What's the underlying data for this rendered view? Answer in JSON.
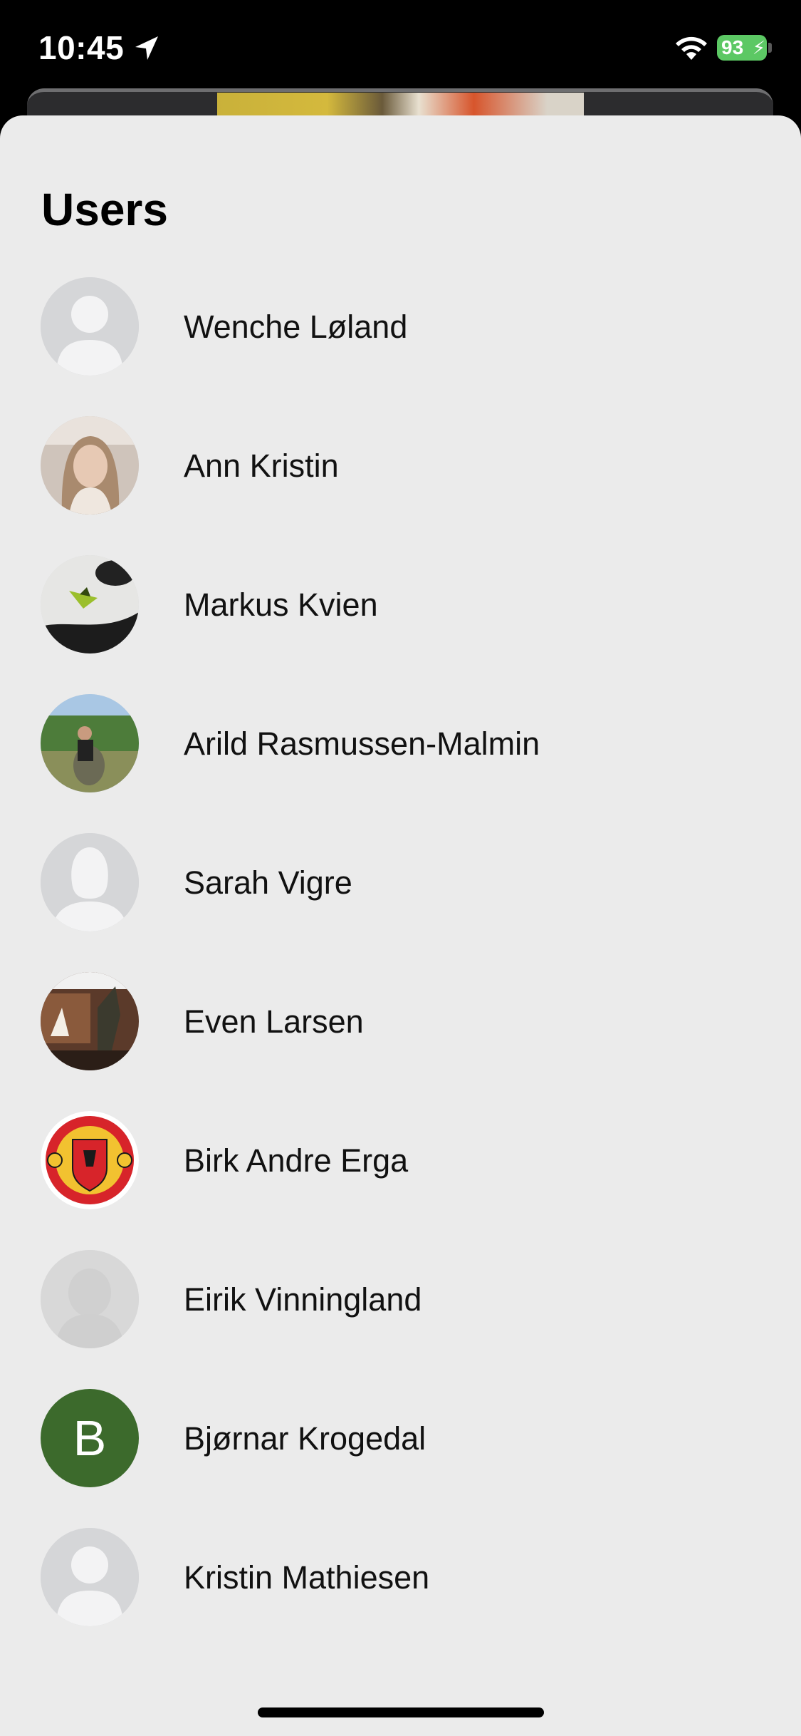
{
  "status_bar": {
    "time": "10:45",
    "battery": "93",
    "location_icon": "location-arrow-icon",
    "wifi_icon": "wifi-icon",
    "battery_color": "#5cc864"
  },
  "sheet": {
    "title": "Users"
  },
  "users": [
    {
      "name": "Wenche Løland",
      "avatar": "placeholder-person"
    },
    {
      "name": "Ann Kristin",
      "avatar": "photo"
    },
    {
      "name": "Markus Kvien",
      "avatar": "photo"
    },
    {
      "name": "Arild Rasmussen-Malmin",
      "avatar": "photo"
    },
    {
      "name": "Sarah Vigre",
      "avatar": "placeholder-person-female"
    },
    {
      "name": "Even Larsen",
      "avatar": "photo"
    },
    {
      "name": "Birk Andre Erga",
      "avatar": "manchester-united-crest"
    },
    {
      "name": "Eirik Vinningland",
      "avatar": "photo-blurred"
    },
    {
      "name": "Bjørnar Krogedal",
      "avatar": "initial",
      "initial": "B",
      "avatar_color": "#3c6a2c"
    },
    {
      "name": "Kristin Mathiesen",
      "avatar": "placeholder-person"
    }
  ],
  "colors": {
    "sheet_background": "#ebebeb",
    "placeholder_avatar": "#d5d6d8"
  }
}
